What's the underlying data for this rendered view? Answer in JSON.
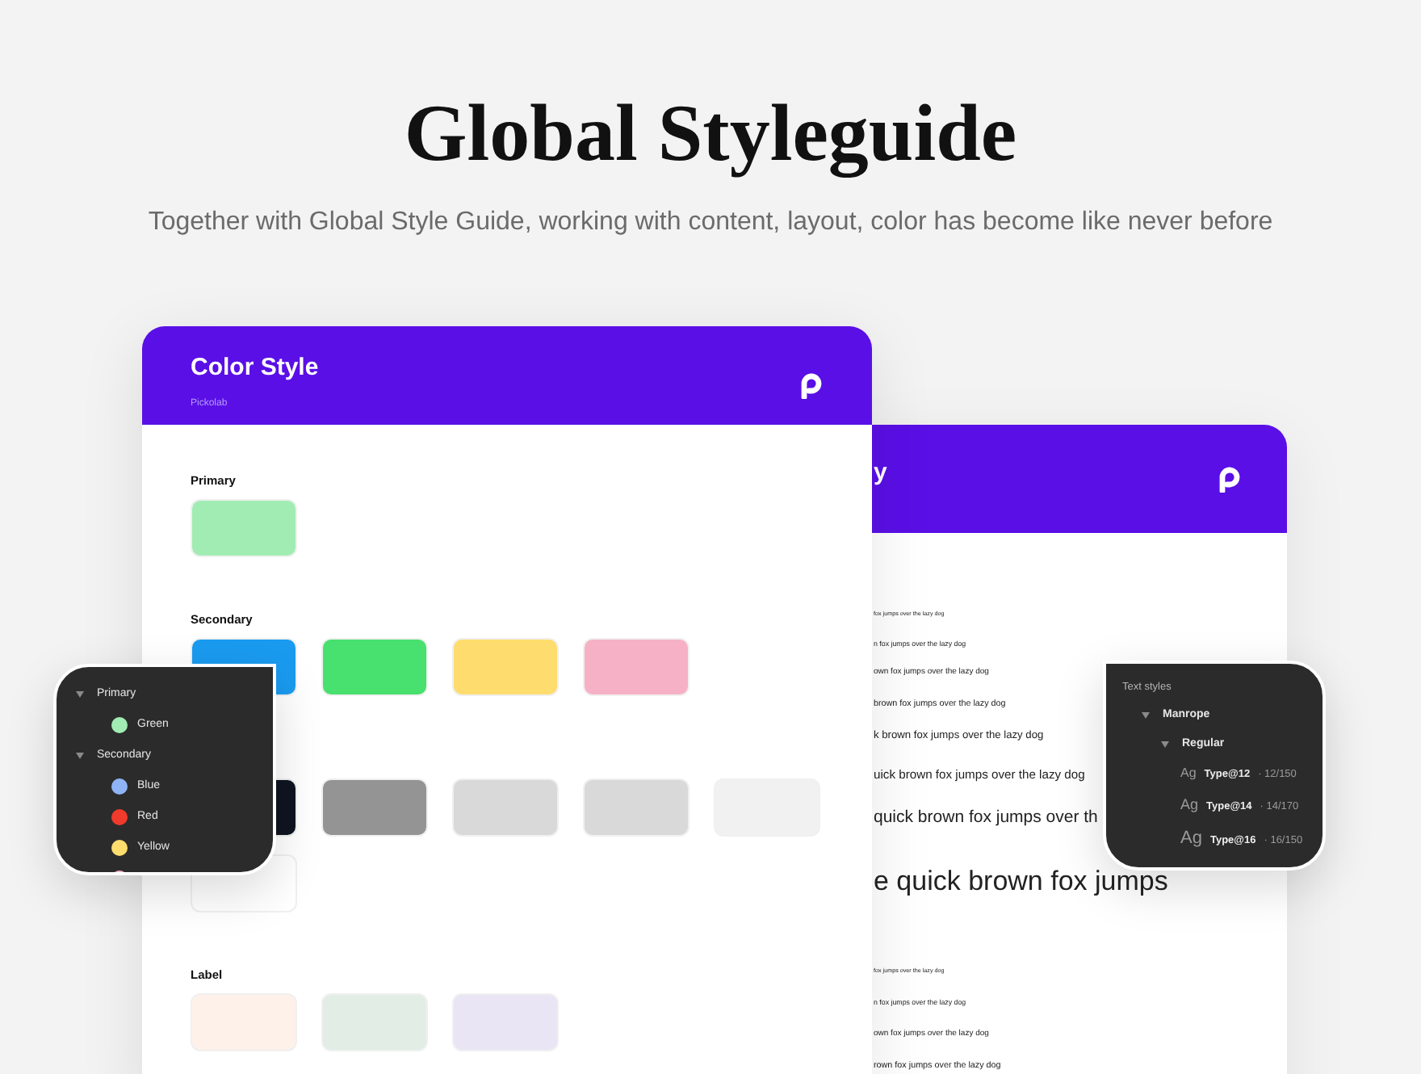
{
  "hero": {
    "title": "Global Styleguide",
    "subtitle": "Together with Global Style Guide, working with content, layout, color has become like never before"
  },
  "back_card": {
    "title": "y",
    "samples": [
      "fox jumps over the lazy dog",
      "n fox jumps over the lazy dog",
      "own fox jumps over the lazy dog",
      "brown fox jumps over the lazy dog",
      "k brown fox jumps over the lazy dog",
      "uick brown fox jumps over the lazy dog",
      "quick brown fox jumps over th",
      "e quick brown fox jumps"
    ],
    "samples_2": [
      "fox jumps over the lazy dog",
      "n fox jumps over the lazy dog",
      "own fox jumps over the lazy dog",
      "rown fox jumps over the lazy dog"
    ]
  },
  "color_card": {
    "title": "Color Style",
    "subtitle": "Pickolab",
    "sections": [
      {
        "label": "Primary",
        "swatches": [
          {
            "color": "#a1ecb3"
          }
        ]
      },
      {
        "label": "Secondary",
        "swatches": [
          {
            "color": "#1a9bf0"
          },
          {
            "color": "#48e06e"
          },
          {
            "color": "#fedd6e"
          },
          {
            "color": "#f7b1c6"
          }
        ]
      },
      {
        "swatches": [
          {
            "color": "#0f1521"
          },
          {
            "color": "#949494"
          },
          {
            "color": "#d9d9d9"
          },
          {
            "color": "#d9d9d9"
          },
          {
            "color": "#f1f1f1"
          },
          {
            "color": "#ffffff"
          }
        ]
      },
      {
        "label": "Label",
        "swatches": [
          {
            "color": "#fef1ea"
          },
          {
            "color": "#e2ede6"
          },
          {
            "color": "#e9e5f4"
          }
        ]
      }
    ]
  },
  "color_panel": {
    "items": [
      {
        "kind": "group",
        "label": "Primary",
        "children": [
          {
            "kind": "color",
            "label": "Green",
            "color": "#a1ecb3"
          }
        ]
      },
      {
        "kind": "group",
        "label": "Secondary",
        "children": [
          {
            "kind": "color",
            "label": "Blue",
            "color": "#8fb4f5"
          },
          {
            "kind": "color",
            "label": "Red",
            "color": "#ef3a2c"
          },
          {
            "kind": "color",
            "label": "Yellow",
            "color": "#fedd6e"
          },
          {
            "kind": "color",
            "color": "#f7b1c6"
          }
        ]
      }
    ]
  },
  "text_panel": {
    "title": "Text styles",
    "items": [
      {
        "kind": "group",
        "label": "Manrope",
        "children": [
          {
            "kind": "group",
            "label": "Regular",
            "children": [
              {
                "kind": "style",
                "sample": "Ag",
                "name": "Type@12",
                "spec": "· 12/150"
              },
              {
                "kind": "style",
                "sample": "Ag",
                "name": "Type@14",
                "spec": "· 14/170"
              },
              {
                "kind": "style",
                "sample": "Ag",
                "name": "Type@16",
                "spec": "· 16/150"
              }
            ]
          }
        ]
      }
    ]
  }
}
